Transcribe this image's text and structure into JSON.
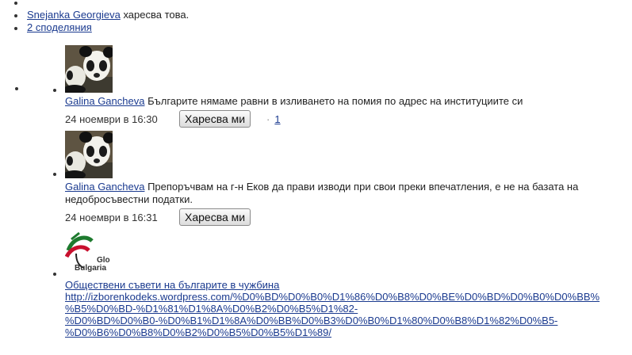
{
  "top": {
    "liker_name": "Snejanka Georgieva",
    "liker_suffix": "харесва това.",
    "shares_link": "2 споделяния"
  },
  "comments": [
    {
      "author": "Galina Gancheva",
      "text": "Българите нямаме равни в изливането на помия по адрес на институциите си",
      "time": "24 ноември в 16:30",
      "like_label": "Харесва ми",
      "like_count": "1",
      "avatar_icon": "panda-avatar-icon"
    },
    {
      "author": "Galina Gancheva",
      "text_line1": "Препоръчвам на г-н Еков да прави изводи при свои преки впечатления, е не на базата на",
      "text_line2": "недобросъвестни податки.",
      "time": "24 ноември в 16:31",
      "like_label": "Харесва ми",
      "avatar_icon": "panda-avatar-icon"
    },
    {
      "author": "Обществени съвети на българите в чужбина",
      "avatar_text_1": "Glo",
      "avatar_text_2": "Bulgaria",
      "url_lines": [
        "http://izborenkodeks.wordpress.com/%D0%BD%D0%B0%D1%86%D0%B8%D0%BE%D0%BD%D0%B0%D0%BB%",
        "%B5%D0%BD-%D1%81%D1%8A%D0%B2%D0%B5%D1%82-",
        "%D0%BD%D0%B0-%D0%B1%D1%8A%D0%BB%D0%B3%D0%B0%D1%80%D0%B8%D1%82%D0%B5-",
        "%D0%B6%D0%B8%D0%B2%D0%B5%D0%B5%D1%89/"
      ],
      "avatar_icon": "globe-bulgaria-logo-icon"
    }
  ]
}
